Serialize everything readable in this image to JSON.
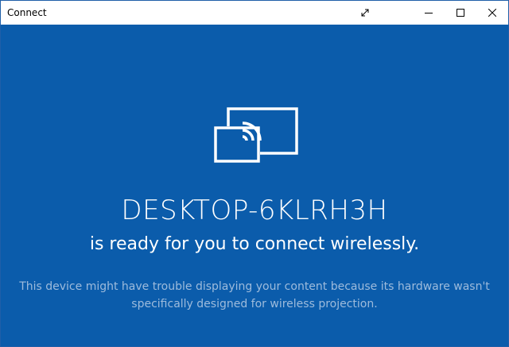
{
  "window": {
    "title": "Connect",
    "controls": {
      "resize_icon": "diagonal-arrows-icon",
      "minimize_icon": "minimize-icon",
      "maximize_icon": "maximize-icon",
      "close_icon": "close-icon"
    }
  },
  "main": {
    "icon": "wireless-projection-icon",
    "device_name": "DESKTOP-6KLRH3H",
    "status_message": "is ready for you to connect wirelessly.",
    "warning_message": "This device might have trouble displaying your content because its hardware wasn't specifically designed for wireless projection."
  },
  "colors": {
    "background": "#0b5cab",
    "title_bar": "#ffffff",
    "primary_text": "#ffffff",
    "secondary_text": "#9dbbdc"
  }
}
